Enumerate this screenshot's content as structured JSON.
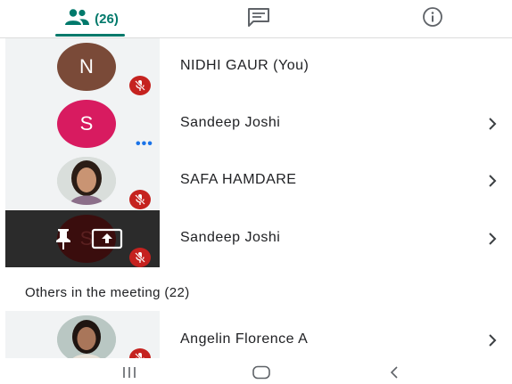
{
  "tabs": {
    "people_count": "(26)",
    "people_icon": "people-icon",
    "chat_icon": "chat-icon",
    "info_icon": "info-icon"
  },
  "participants": [
    {
      "initial": "N",
      "name": "NIDHI GAUR (You)",
      "avatar_color": "#7a4a38",
      "muted": true
    },
    {
      "initial": "S",
      "name": "Sandeep Joshi",
      "avatar_color": "#d81b60",
      "speaking": true
    },
    {
      "name": "SAFA HAMDARE",
      "avatar": "photo",
      "muted": true
    },
    {
      "initial": "S",
      "name": "Sandeep Joshi",
      "presenting": true,
      "pinned": true,
      "muted": true
    }
  ],
  "others": {
    "header": "Others in the meeting (22)",
    "items": [
      {
        "name": "Angelin Florence A",
        "avatar": "photo",
        "muted": true
      }
    ]
  },
  "colors": {
    "accent": "#00796b",
    "mute_red": "#c5221f",
    "speaking_blue": "#1a73e8"
  },
  "navbar": {
    "recent_icon": "recent-apps-icon",
    "home_icon": "home-icon",
    "back_icon": "back-icon"
  }
}
